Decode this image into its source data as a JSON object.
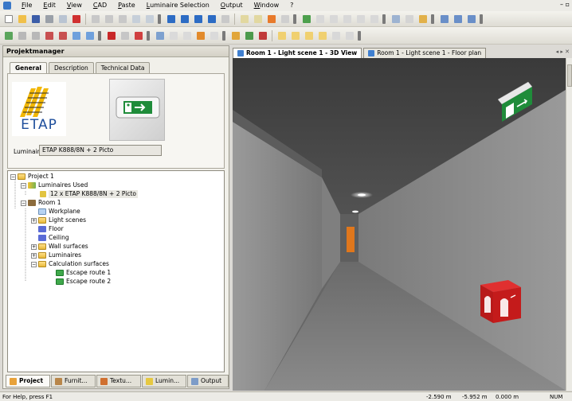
{
  "menu": [
    "File",
    "Edit",
    "View",
    "CAD",
    "Paste",
    "Luminaire Selection",
    "Output",
    "Window",
    "?"
  ],
  "panel": {
    "title": "Projektmanager"
  },
  "prop_tabs": [
    "General",
    "Description",
    "Technical Data"
  ],
  "logo_text": "ETAP",
  "luminaire": {
    "label": "Luminaire",
    "value": "ETAP K888/8N + 2 Picto"
  },
  "tree": {
    "project": "Project 1",
    "luminaires_used": "Luminaires Used",
    "luminaire_item": "12 x ETAP K888/8N + 2 Picto",
    "room": "Room 1",
    "workplane": "Workplane",
    "light_scenes": "Light scenes",
    "floor": "Floor",
    "ceiling": "Ceiling",
    "wall_surfaces": "Wall surfaces",
    "luminaires": "Luminaires",
    "calc_surfaces": "Calculation surfaces",
    "escape1": "Escape route 1",
    "escape2": "Escape route 2"
  },
  "bottom_tabs": [
    "Project",
    "Furnit...",
    "Textu...",
    "Lumin...",
    "Output"
  ],
  "view_tabs": [
    "Room 1 - Light scene 1 - 3D View",
    "Room 1 - Light scene 1 - Floor plan"
  ],
  "view_nav": "◂ ▸ ✕",
  "status": {
    "help": "For Help, press F1",
    "x": "-2.590 m",
    "y": "-5.952 m",
    "z": "0.000 m",
    "mode": "NUM"
  },
  "colors": {
    "accent": "#3f7fd0",
    "exit_sign_green": "#1f8c3a",
    "extinguisher_red": "#c41b1b",
    "door_orange": "#e0771c"
  },
  "icons": {
    "exit_sign": "running-man-exit-icon",
    "fire_extinguisher_cube": "fire-extinguisher-icon"
  }
}
